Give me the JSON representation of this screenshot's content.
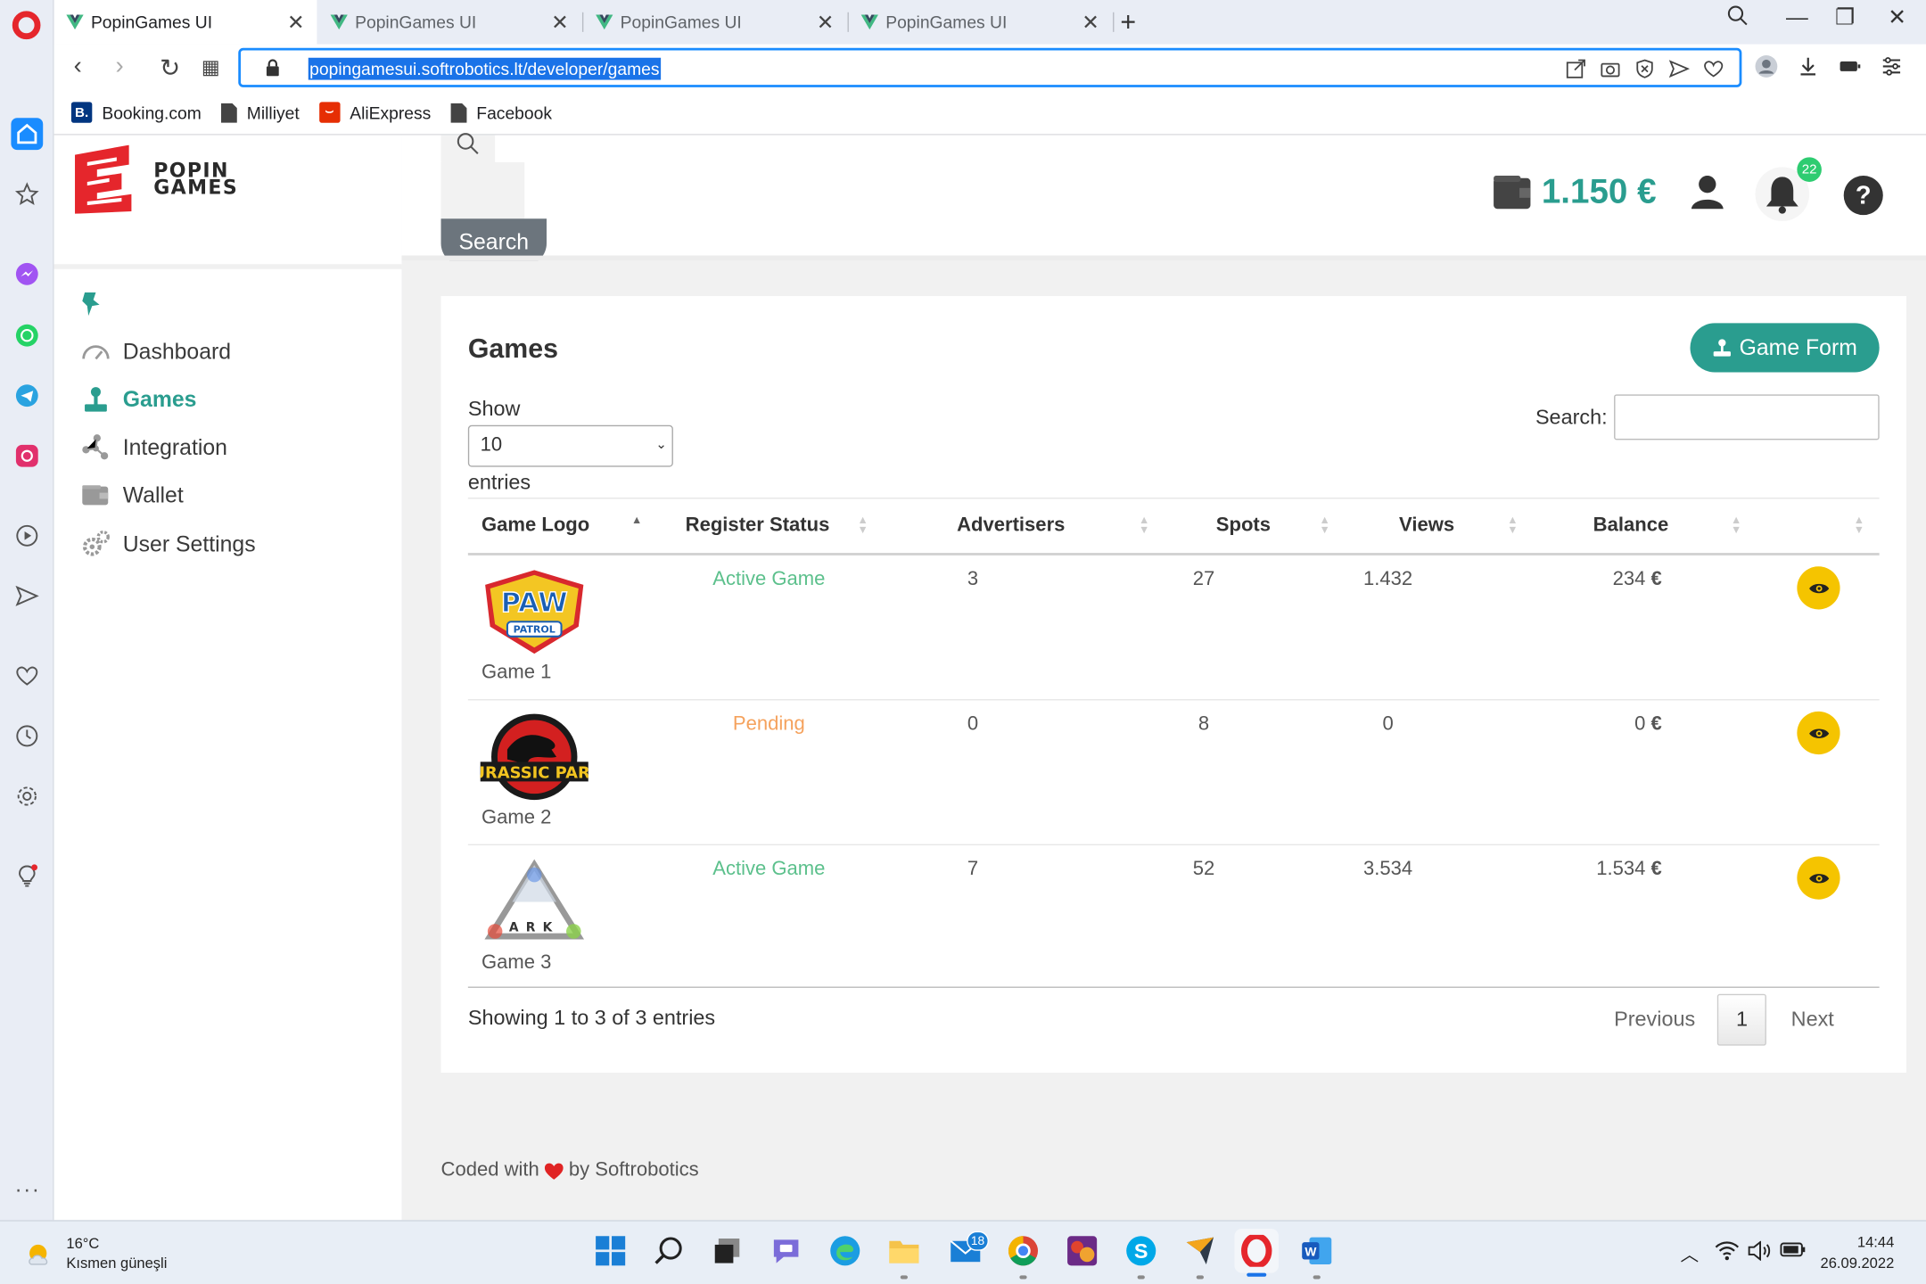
{
  "browser": {
    "tabs": [
      {
        "title": "PopinGames UI",
        "active": true
      },
      {
        "title": "PopinGames UI",
        "active": false
      },
      {
        "title": "PopinGames UI",
        "active": false
      },
      {
        "title": "PopinGames UI",
        "active": false
      }
    ],
    "url": "popingamesui.softrobotics.lt/developer/games",
    "bookmarks": [
      {
        "label": "Booking.com",
        "icon": "booking-icon"
      },
      {
        "label": "Milliyet",
        "icon": "page-icon"
      },
      {
        "label": "AliExpress",
        "icon": "aliexpress-icon"
      },
      {
        "label": "Facebook",
        "icon": "page-icon"
      }
    ]
  },
  "brand": {
    "line1": "POPIN",
    "line2": "GAMES",
    "accent": "#e5262c"
  },
  "sidebar": {
    "items": [
      {
        "label": "Dashboard",
        "icon": "speedometer-icon",
        "active": false
      },
      {
        "label": "Games",
        "icon": "joystick-icon",
        "active": true
      },
      {
        "label": "Integration",
        "icon": "nodes-icon",
        "active": false
      },
      {
        "label": "Wallet",
        "icon": "wallet-icon",
        "active": false
      },
      {
        "label": "User Settings",
        "icon": "gears-icon",
        "active": false
      }
    ]
  },
  "topbar": {
    "search_button": "Search",
    "balance": "1.150 €",
    "notifications": "22",
    "accent": "#2a9d8f"
  },
  "games": {
    "title": "Games",
    "form_button": "Game Form",
    "show_label": "Show",
    "page_size": "10",
    "entries_label": "entries",
    "search_label": "Search:",
    "columns": [
      "Game Logo",
      "Register Status",
      "Advertisers",
      "Spots",
      "Views",
      "Balance"
    ],
    "rows": [
      {
        "name": "Game 1",
        "logo": "paw-patrol-logo",
        "status": "Active Game",
        "status_color": "#5cc08c",
        "advertisers": "3",
        "spots": "27",
        "views": "1.432",
        "balance": "234",
        "currency": "€"
      },
      {
        "name": "Game 2",
        "logo": "jurassic-park-logo",
        "status": "Pending",
        "status_color": "#f5a25d",
        "advertisers": "0",
        "spots": "8",
        "views": "0",
        "balance": "0",
        "currency": "€"
      },
      {
        "name": "Game 3",
        "logo": "ark-logo",
        "status": "Active Game",
        "status_color": "#5cc08c",
        "advertisers": "7",
        "spots": "52",
        "views": "3.534",
        "balance": "1.534",
        "currency": "€"
      }
    ],
    "showing": "Showing 1 to 3 of 3 entries",
    "pager": {
      "prev": "Previous",
      "page": "1",
      "next": "Next"
    }
  },
  "footer": {
    "before": "Coded with",
    "after": "by Softrobotics"
  },
  "taskbar": {
    "temperature": "16°C",
    "weather": "Kısmen güneşli",
    "mail_badge": "18",
    "time": "14:44",
    "date": "26.09.2022"
  }
}
